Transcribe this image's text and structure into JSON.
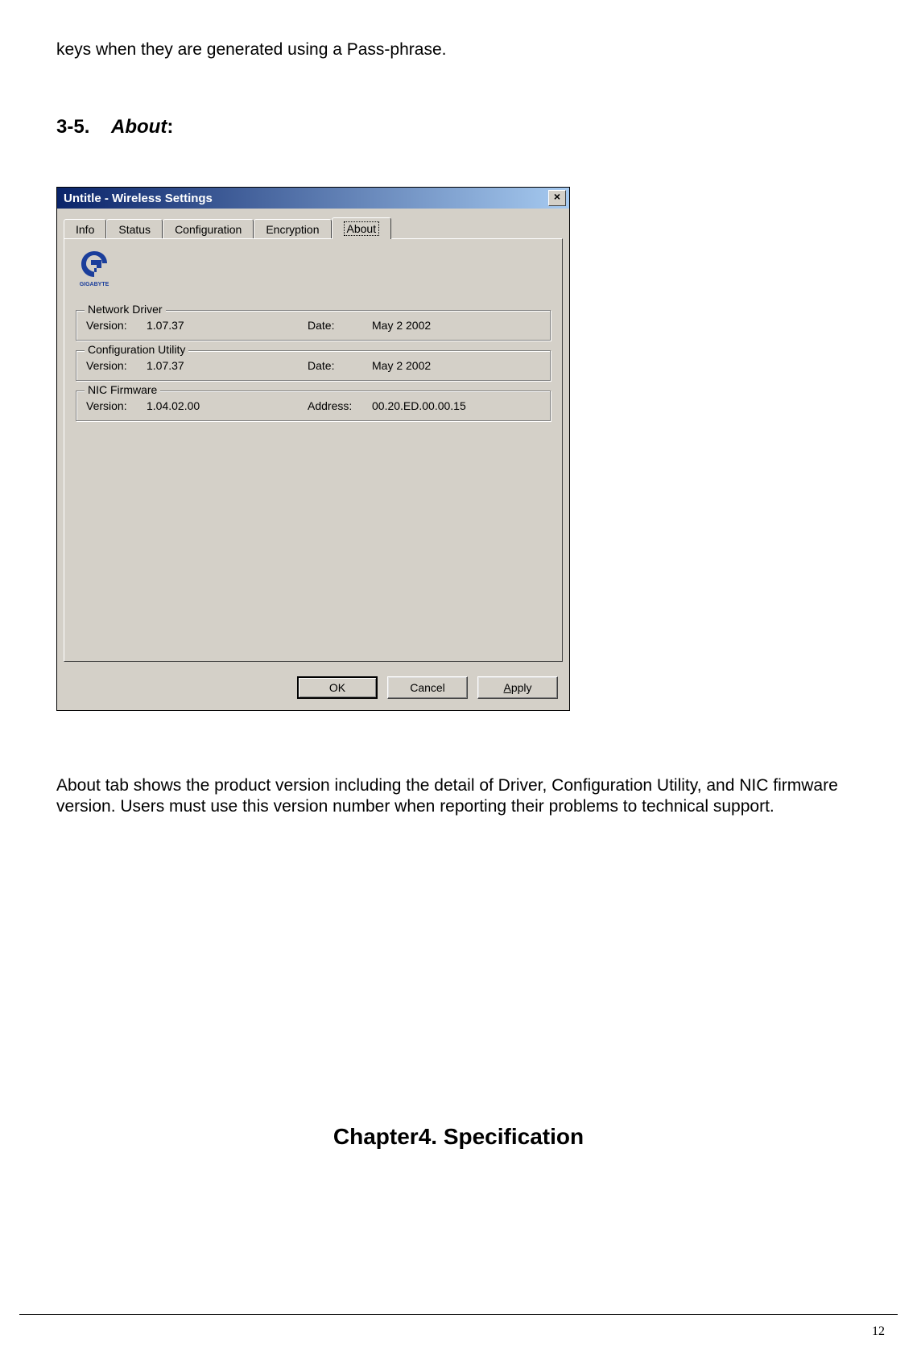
{
  "intro_line": "keys when they are generated using a Pass-phrase.",
  "section": {
    "number": "3-5.",
    "title": "About",
    "suffix": ":"
  },
  "dialog": {
    "title": "Untitle - Wireless Settings",
    "close_glyph": "×",
    "tabs": [
      "Info",
      "Status",
      "Configuration",
      "Encryption",
      "About"
    ],
    "active_tab": "About",
    "logo_text": "GIGABYTE",
    "groups": [
      {
        "legend": "Network Driver",
        "version_label": "Version:",
        "version": "1.07.37",
        "field2_label": "Date:",
        "field2_value": "May  2 2002"
      },
      {
        "legend": "Configuration Utility",
        "version_label": "Version:",
        "version": "1.07.37",
        "field2_label": "Date:",
        "field2_value": "May  2 2002"
      },
      {
        "legend": "NIC Firmware",
        "version_label": "Version:",
        "version": "1.04.02.00",
        "field2_label": "Address:",
        "field2_value": "00.20.ED.00.00.15"
      }
    ],
    "buttons": {
      "ok": "OK",
      "cancel": "Cancel",
      "apply_prefix": "A",
      "apply_rest": "pply"
    }
  },
  "body_para": "About tab shows the product version including the detail of Driver, Configuration Utility, and NIC firmware version. Users must use this version number when reporting their problems to technical support.",
  "chapter_heading": "Chapter4. Specification",
  "page_number": "12"
}
